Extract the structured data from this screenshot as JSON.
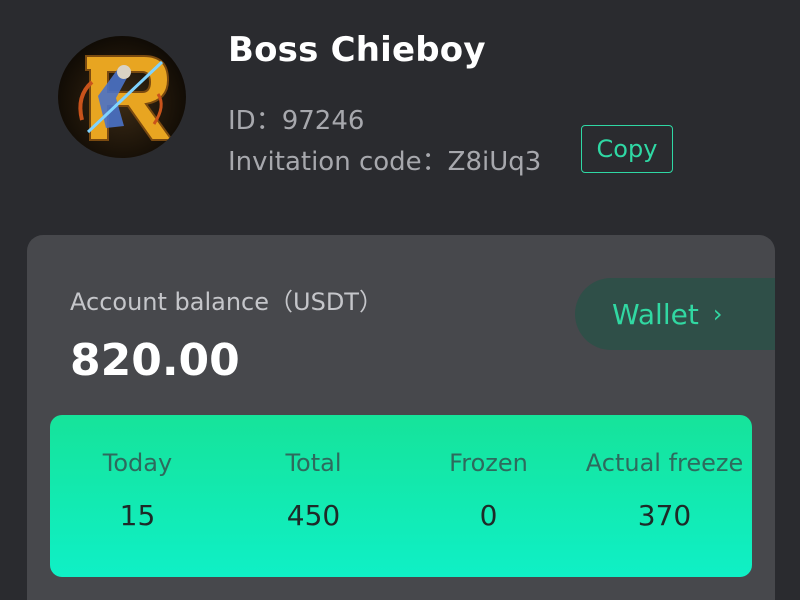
{
  "profile": {
    "avatar_icon": "knight-logo-icon",
    "username": "Boss Chieboy",
    "id_text": "ID：97246",
    "invitation_text": "Invitation code：Z8iUq3",
    "copy_label": "Copy"
  },
  "balance": {
    "label": "Account balance（USDT）",
    "value": "820.00",
    "wallet_label": "Wallet",
    "wallet_chevron": "›"
  },
  "stats": [
    {
      "label": "Today",
      "value": "15"
    },
    {
      "label": "Total",
      "value": "450"
    },
    {
      "label": "Frozen",
      "value": "0"
    },
    {
      "label": "Actual freeze",
      "value": "370"
    }
  ],
  "colors": {
    "background": "#2a2b2f",
    "card": "#47484c",
    "accent": "#2fd8a4",
    "stats_gradient_top": "#16e39a",
    "stats_gradient_bottom": "#0ff0c6"
  }
}
